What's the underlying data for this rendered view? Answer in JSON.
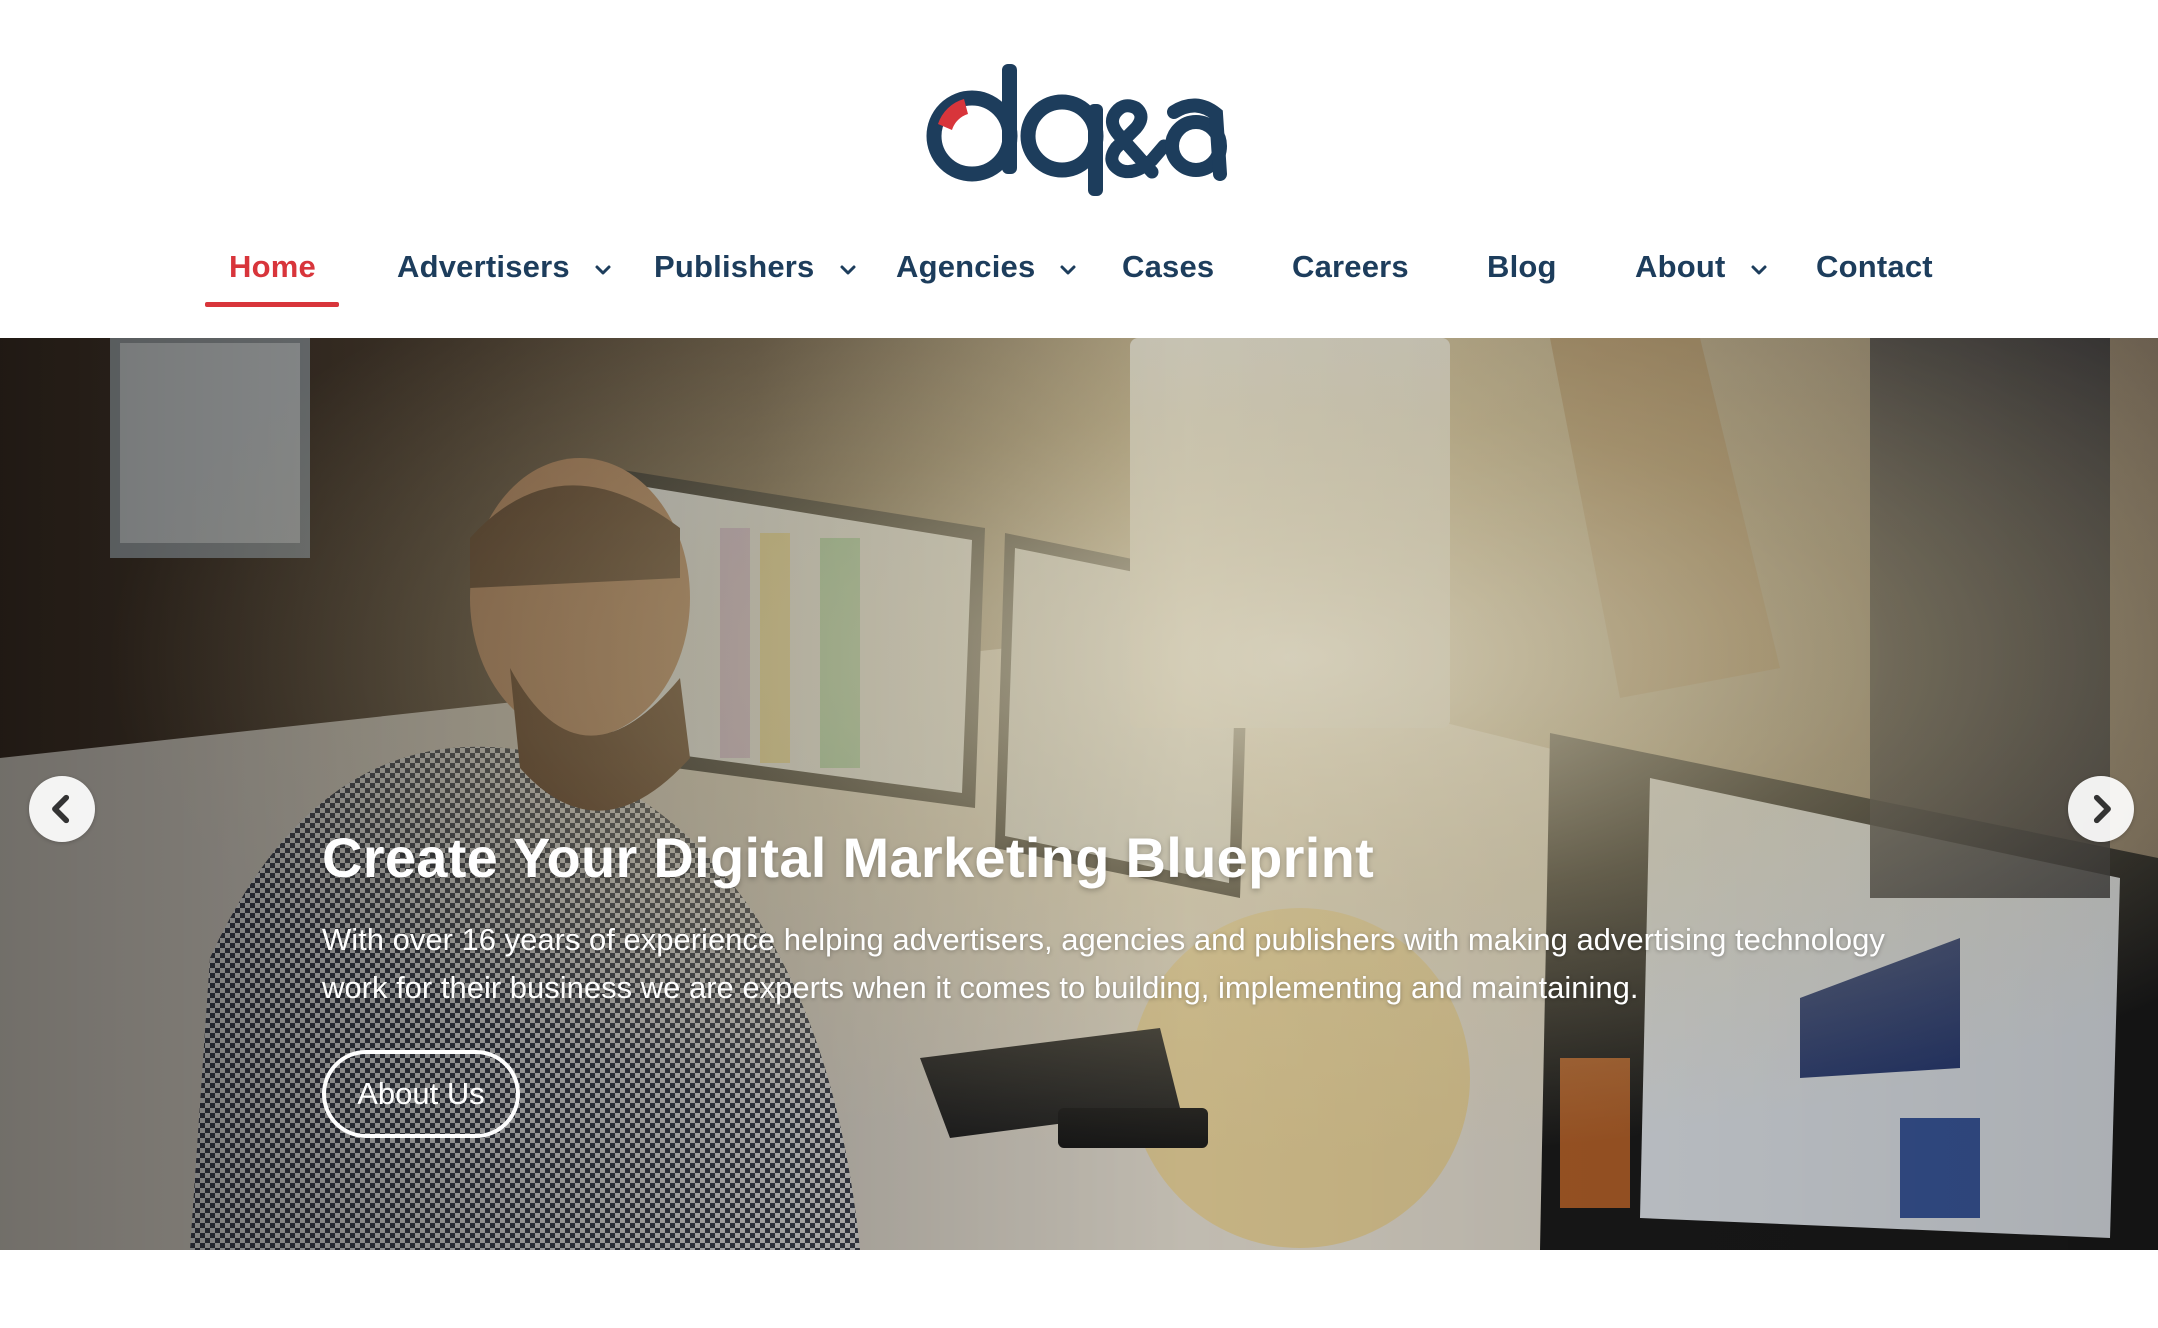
{
  "brand": {
    "logo_text": "dq&a",
    "primary_color": "#1d3d5c",
    "accent_color": "#d8353b"
  },
  "nav": {
    "items": [
      {
        "label": "Home",
        "active": true,
        "has_dropdown": false
      },
      {
        "label": "Advertisers",
        "active": false,
        "has_dropdown": true
      },
      {
        "label": "Publishers",
        "active": false,
        "has_dropdown": true
      },
      {
        "label": "Agencies",
        "active": false,
        "has_dropdown": true
      },
      {
        "label": "Cases",
        "active": false,
        "has_dropdown": false
      },
      {
        "label": "Careers",
        "active": false,
        "has_dropdown": false
      },
      {
        "label": "Blog",
        "active": false,
        "has_dropdown": false
      },
      {
        "label": "About",
        "active": false,
        "has_dropdown": true
      },
      {
        "label": "Contact",
        "active": false,
        "has_dropdown": false
      }
    ],
    "dropdown_icon": "chevron-down-icon"
  },
  "hero": {
    "title": "Create Your Digital Marketing Blueprint",
    "text": "With over 16 years of experience helping advertisers, agencies and publishers with making advertising technology work for their business we are experts when it comes to building, implementing and maintaining.",
    "button_label": "About Us",
    "prev_icon": "chevron-left-icon",
    "next_icon": "chevron-right-icon"
  }
}
